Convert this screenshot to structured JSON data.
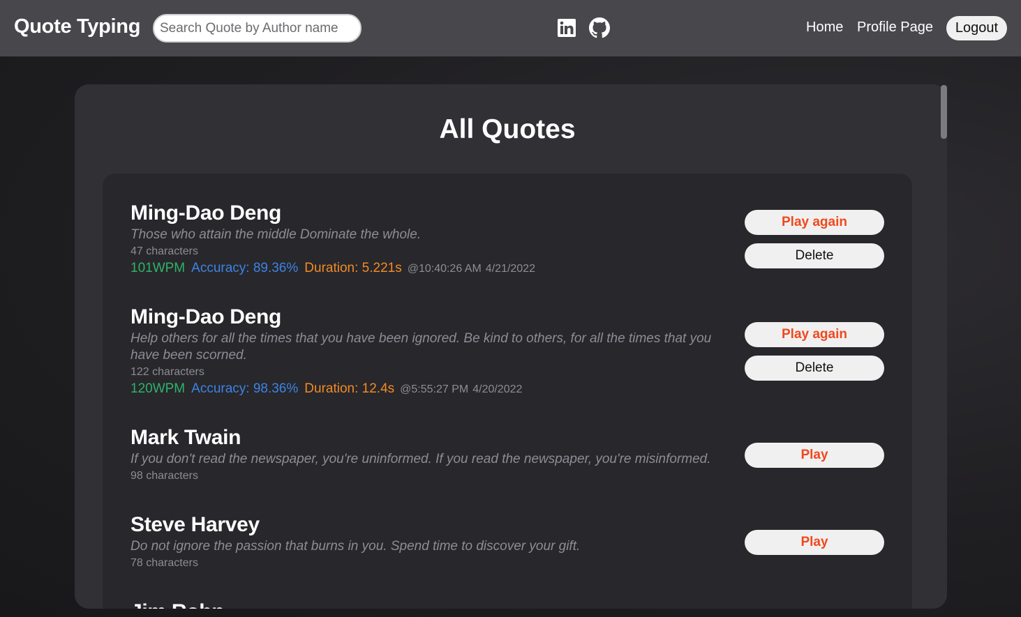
{
  "navbar": {
    "brand": "Quote Typing",
    "search_placeholder": "Search Quote by Author name",
    "social": [
      {
        "icon": "linkedin-icon"
      },
      {
        "icon": "github-icon"
      }
    ],
    "links": {
      "home": "Home",
      "profile": "Profile Page"
    },
    "logout_label": "Logout"
  },
  "page": {
    "title": "All Quotes"
  },
  "quotes": [
    {
      "author": "Ming-Dao Deng",
      "text": "Those who attain the middle Dominate the whole.",
      "characters": "47 characters",
      "wpm": "101WPM",
      "accuracy": "Accuracy: 89.36%",
      "duration": "Duration: 5.221s",
      "time": "@10:40:26 AM",
      "date": "4/21/2022",
      "play_label": "Play again",
      "delete_label": "Delete"
    },
    {
      "author": "Ming-Dao Deng",
      "text": "Help others for all the times that you have been ignored. Be kind to others, for all the times that you have been scorned.",
      "characters": "122 characters",
      "wpm": "120WPM",
      "accuracy": "Accuracy: 98.36%",
      "duration": "Duration: 12.4s",
      "time": "@5:55:27 PM",
      "date": "4/20/2022",
      "play_label": "Play again",
      "delete_label": "Delete"
    },
    {
      "author": "Mark Twain",
      "text": "If you don't read the newspaper, you're uninformed. If you read the newspaper, you're misinformed.",
      "characters": "98 characters",
      "play_label": "Play"
    },
    {
      "author": "Steve Harvey",
      "text": "Do not ignore the passion that burns in you. Spend time to discover your gift.",
      "characters": "78 characters",
      "play_label": "Play"
    },
    {
      "author": "Jim Rohn"
    }
  ],
  "colors": {
    "navbar_bg": "#48474c",
    "panel_bg": "#313035",
    "list_bg": "#28272b",
    "wpm": "#2eb36a",
    "accuracy": "#3c84e6",
    "duration": "#f18b26",
    "play_button_text": "#f1481c"
  }
}
